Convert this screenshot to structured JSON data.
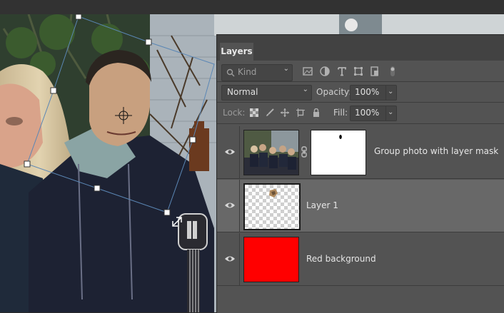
{
  "app": {
    "accent": "#31a8ff"
  },
  "panel": {
    "tab_label": "Layers",
    "filter": {
      "kind_placeholder": "Kind"
    },
    "blend_mode": "Normal",
    "opacity_label": "Opacity:",
    "opacity_value": "100%",
    "lock_label": "Lock:",
    "fill_label": "Fill:",
    "fill_value": "100%"
  },
  "layers": [
    {
      "name": "Group photo with layer mask",
      "visible": true,
      "selected": false,
      "has_mask": true
    },
    {
      "name": "Layer 1",
      "visible": true,
      "selected": true,
      "has_mask": false
    },
    {
      "name": "Red background",
      "visible": true,
      "selected": false,
      "has_mask": false,
      "fill_color": "#ff0000"
    }
  ]
}
